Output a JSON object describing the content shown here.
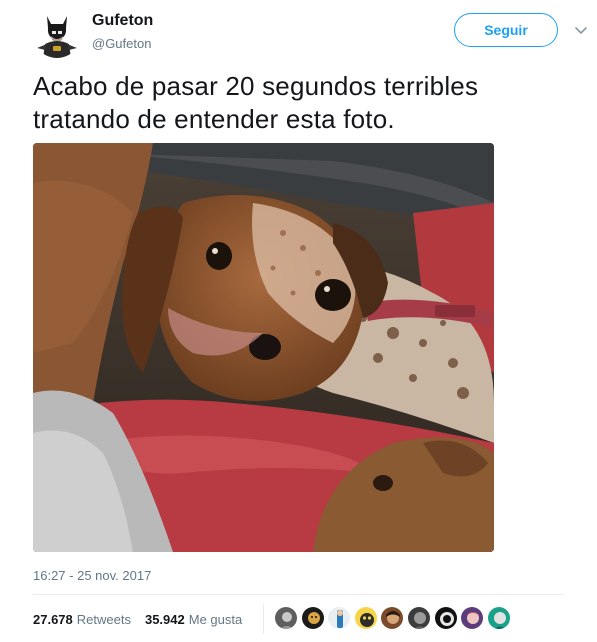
{
  "tweet": {
    "author": {
      "display_name": "Gufeton",
      "handle": "@Gufeton",
      "avatar_icon": "batman-avatar-icon"
    },
    "follow_label": "Seguir",
    "text": "Acabo de pasar 20 segundos terribles tratando de entender esta foto.",
    "timestamp": "16:27 - 25 nov. 2017",
    "stats": {
      "retweets_count": "27.678",
      "retweets_label": "Retweets",
      "likes_count": "35.942",
      "likes_label": "Me gusta"
    },
    "likers_count_shown": 9
  },
  "colors": {
    "accent": "#1da1f2",
    "secondary_text": "#657786",
    "primary_text": "#14171a",
    "divider": "#e6ecf0"
  }
}
